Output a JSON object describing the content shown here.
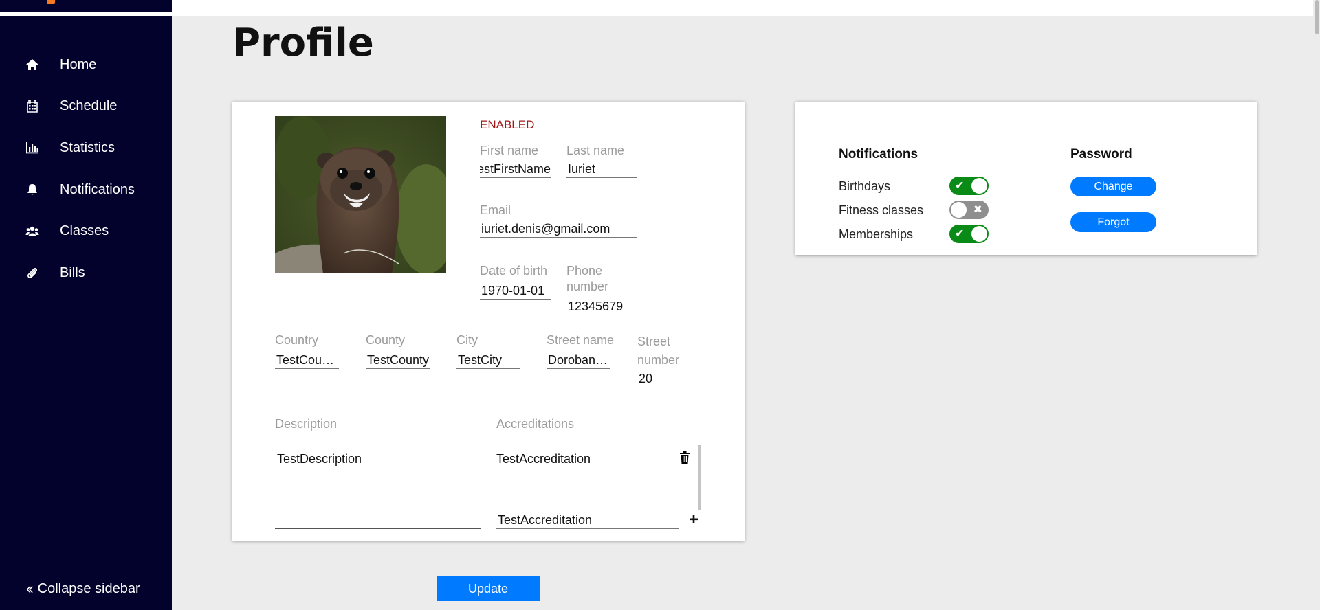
{
  "sidebar": {
    "items": [
      {
        "label": "Home",
        "icon": "home-icon"
      },
      {
        "label": "Schedule",
        "icon": "calendar-icon"
      },
      {
        "label": "Statistics",
        "icon": "bar-chart-icon"
      },
      {
        "label": "Notifications",
        "icon": "bell-icon"
      },
      {
        "label": "Classes",
        "icon": "users-icon"
      },
      {
        "label": "Bills",
        "icon": "paperclip-icon"
      }
    ],
    "collapse_label": "Collapse sidebar",
    "background": "#03022c",
    "logo_accent": "#f47b20"
  },
  "page": {
    "title": "Profile"
  },
  "profile": {
    "status": "ENABLED",
    "first_name": {
      "label": "First name",
      "value": "estFirstName"
    },
    "last_name": {
      "label": "Last name",
      "value": "Iuriet"
    },
    "email": {
      "label": "Email",
      "value": "iuriet.denis@gmail.com"
    },
    "dob": {
      "label": "Date of birth",
      "value": "1970-01-01"
    },
    "phone": {
      "label_line1": "Phone",
      "label_line2": "number",
      "value": "12345679"
    },
    "country": {
      "label": "Country",
      "value": "TestCou…"
    },
    "county": {
      "label": "County",
      "value": "TestCounty"
    },
    "city": {
      "label": "City",
      "value": "TestCity"
    },
    "street_name": {
      "label": "Street name",
      "value": "Doroban…"
    },
    "street_number": {
      "label_line1": "Street",
      "label_line2": "number",
      "value": "20"
    },
    "description": {
      "label": "Description",
      "value": "TestDescription"
    },
    "accreditations": {
      "label": "Accreditations",
      "items": [
        "TestAccreditation"
      ],
      "new_value": "TestAccreditation"
    },
    "update_label": "Update"
  },
  "settings": {
    "notifications": {
      "title": "Notifications",
      "items": [
        {
          "label": "Birthdays",
          "enabled": true
        },
        {
          "label": "Fitness classes",
          "enabled": false
        },
        {
          "label": "Memberships",
          "enabled": true
        }
      ]
    },
    "password": {
      "title": "Password",
      "change_label": "Change",
      "forgot_label": "Forgot"
    }
  },
  "colors": {
    "primary_button": "#007bff",
    "toggle_on": "#0a8a17",
    "toggle_off": "#8f8f8f",
    "status_text": "#a01818"
  }
}
